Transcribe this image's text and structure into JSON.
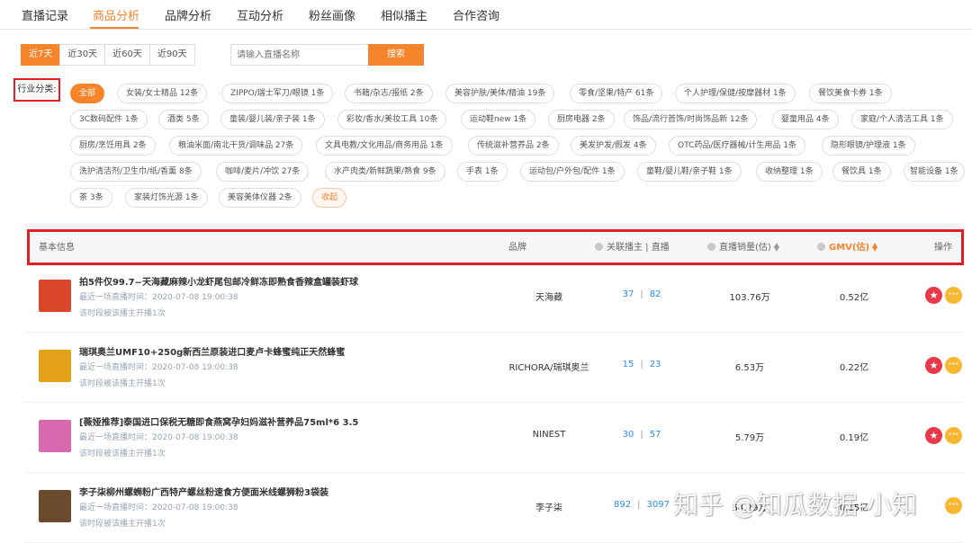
{
  "nav": {
    "tabs": [
      "直播记录",
      "商品分析",
      "品牌分析",
      "互动分析",
      "粉丝画像",
      "相似播主",
      "合作咨询"
    ],
    "active": "商品分析"
  },
  "filters": {
    "ranges": [
      "近7天",
      "近30天",
      "近60天",
      "近90天"
    ],
    "active_range": "近7天",
    "search_placeholder": "请输入直播名称",
    "search_button": "搜索"
  },
  "categories": {
    "label": "行业分类:",
    "items": [
      "全部",
      "女装/女士精品 12条",
      "ZIPPO/瑞士军刀/眼镜 1条",
      "书籍/杂志/报纸 2条",
      "美容护肤/美体/精油 19条",
      "零食/坚果/特产 61条",
      "个人护理/保健/按摩器材 1条",
      "餐饮美食卡券 1条",
      "3C数码配件 1条",
      "酒类 5条",
      "童装/婴儿装/亲子装 1条",
      "彩妆/香水/美妆工具 10条",
      "运动鞋new 1条",
      "厨房电器 2条",
      "饰品/流行首饰/时尚饰品新 12条",
      "婴童用品 4条",
      "家庭/个人清洁工具 1条",
      "厨房/烹饪用具 2条",
      "粮油米面/南北干货/调味品 27条",
      "文具电教/文化用品/商务用品 1条",
      "传统滋补营养品 2条",
      "美发护发/假发 4条",
      "OTC药品/医疗器械/计生用品 1条",
      "隐形眼镜/护理液 1条",
      "洗护清洁剂/卫生巾/纸/香薰 8条",
      "咖啡/麦片/冲饮 27条",
      "水产肉类/新鲜蔬果/熟食 9条",
      "手表 1条",
      "运动包/户外包/配件 1条",
      "童鞋/婴儿鞋/亲子鞋 1条",
      "收纳整理 1条",
      "餐饮具 1条",
      "智能设备 1条",
      "茶 3条",
      "家装灯饰光源 1条",
      "美容美体仪器 2条"
    ],
    "collapse": "收起"
  },
  "table": {
    "headers": {
      "info": "基本信息",
      "brand": "品牌",
      "anchors": "关联播主 | 直播",
      "sales": "直播销量(估)",
      "gmv": "GMV(估)",
      "action": "操作"
    },
    "rows": [
      {
        "title": "拍5件仅99.7~天海藏麻辣小龙虾尾包邮冷鲜冻即熟食香辣盒罐装虾球",
        "last_live": "最近一场直播时间：2020-07-08 19:00:38",
        "period": "该时段被该播主开播1次",
        "brand": "天海藏",
        "anchors": "37",
        "lives": "82",
        "sales": "103.76万",
        "gmv": "0.52亿",
        "thumb_color": "#d9472b"
      },
      {
        "title": "瑞琪奥兰UMF10+250g新西兰原装进口麦卢卡蜂蜜纯正天然蜂蜜",
        "last_live": "最近一场直播时间：2020-07-08 19:00:38",
        "period": "该时段被该播主开播1次",
        "brand": "RICHORA/瑞琪奥兰",
        "anchors": "15",
        "lives": "23",
        "sales": "6.53万",
        "gmv": "0.22亿",
        "thumb_color": "#e3a21a"
      },
      {
        "title": "[薇娅推荐]泰国进口保税无糖即食燕窝孕妇妈滋补营养品75ml*6 3.5",
        "last_live": "最近一场直播时间：2020-07-08 19:00:38",
        "period": "该时段被该播主开播1次",
        "brand": "NINEST",
        "anchors": "30",
        "lives": "57",
        "sales": "5.79万",
        "gmv": "0.19亿",
        "thumb_color": "#d868b0"
      },
      {
        "title": "李子柒柳州螺蛳粉广西特产螺丝粉速食方便面米线螺狮粉3袋装",
        "last_live": "最近一场直播时间：2020-07-08 19:00:38",
        "period": "该时段被该播主开播1次",
        "brand": "李子柒",
        "anchors": "892",
        "lives": "3097",
        "sales": "54.29万",
        "gmv": "0.15亿",
        "thumb_color": "#6b4a2e"
      }
    ]
  },
  "watermark": "知乎 @知瓜数据-小知"
}
